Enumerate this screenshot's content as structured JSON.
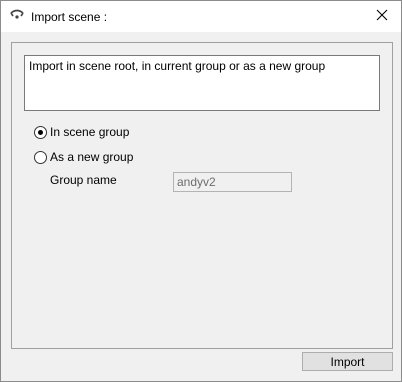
{
  "window": {
    "title": "Import scene :",
    "icon": "app-icon",
    "close_icon": "close-icon"
  },
  "description": "Import in scene root, in current group or as a new group",
  "options": {
    "in_scene_group": {
      "label": "In scene group",
      "selected": true
    },
    "as_new_group": {
      "label": "As a new group",
      "selected": false
    }
  },
  "group_name": {
    "label": "Group name",
    "value": "andyv2",
    "enabled": false
  },
  "buttons": {
    "import_label": "Import"
  },
  "colors": {
    "title_bar": "#ffffff",
    "dialog_bg": "#f0f0f0",
    "disabled_text": "#6d6d6d",
    "button_bg": "#e1e1e1"
  }
}
